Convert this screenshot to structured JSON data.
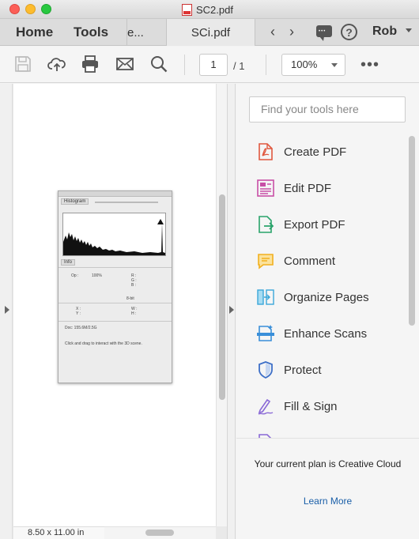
{
  "window": {
    "title": "SC2.pdf"
  },
  "tabbar": {
    "home": "Home",
    "tools": "Tools",
    "tab_partial": "e...",
    "tab_active": "SCi.pdf",
    "user": "Rob"
  },
  "toolbar": {
    "page_current": "1",
    "page_total": "/ 1",
    "zoom": "100%"
  },
  "document": {
    "page_size": "8.50 x 11.00 in",
    "panel": {
      "histogram_tab": "Histogram",
      "info_tab": "Info",
      "op": "Op :",
      "op_value": "100%",
      "rgb": "R :\nG :\nB :",
      "bits": "8-bit",
      "xy": "X :\nY :",
      "wh": "W :\nH :",
      "doc_info": "Doc: 155.6M/2.5G",
      "hint": "Click and drag to interact with the 3D scene."
    }
  },
  "right_pane": {
    "search_placeholder": "Find your tools here",
    "tools": [
      {
        "label": "Create PDF",
        "icon": "create-pdf-icon",
        "color": "#e0583f"
      },
      {
        "label": "Edit PDF",
        "icon": "edit-pdf-icon",
        "color": "#c84fa6"
      },
      {
        "label": "Export PDF",
        "icon": "export-pdf-icon",
        "color": "#2aa36b"
      },
      {
        "label": "Comment",
        "icon": "comment-icon",
        "color": "#f2b01e"
      },
      {
        "label": "Organize Pages",
        "icon": "organize-pages-icon",
        "color": "#3aa7d9"
      },
      {
        "label": "Enhance Scans",
        "icon": "enhance-scans-icon",
        "color": "#3a8fd9"
      },
      {
        "label": "Protect",
        "icon": "protect-icon",
        "color": "#3d6fc7"
      },
      {
        "label": "Fill & Sign",
        "icon": "fill-sign-icon",
        "color": "#8a69d6"
      }
    ],
    "plan_text": "Your current plan is Creative Cloud",
    "learn_more": "Learn More"
  }
}
